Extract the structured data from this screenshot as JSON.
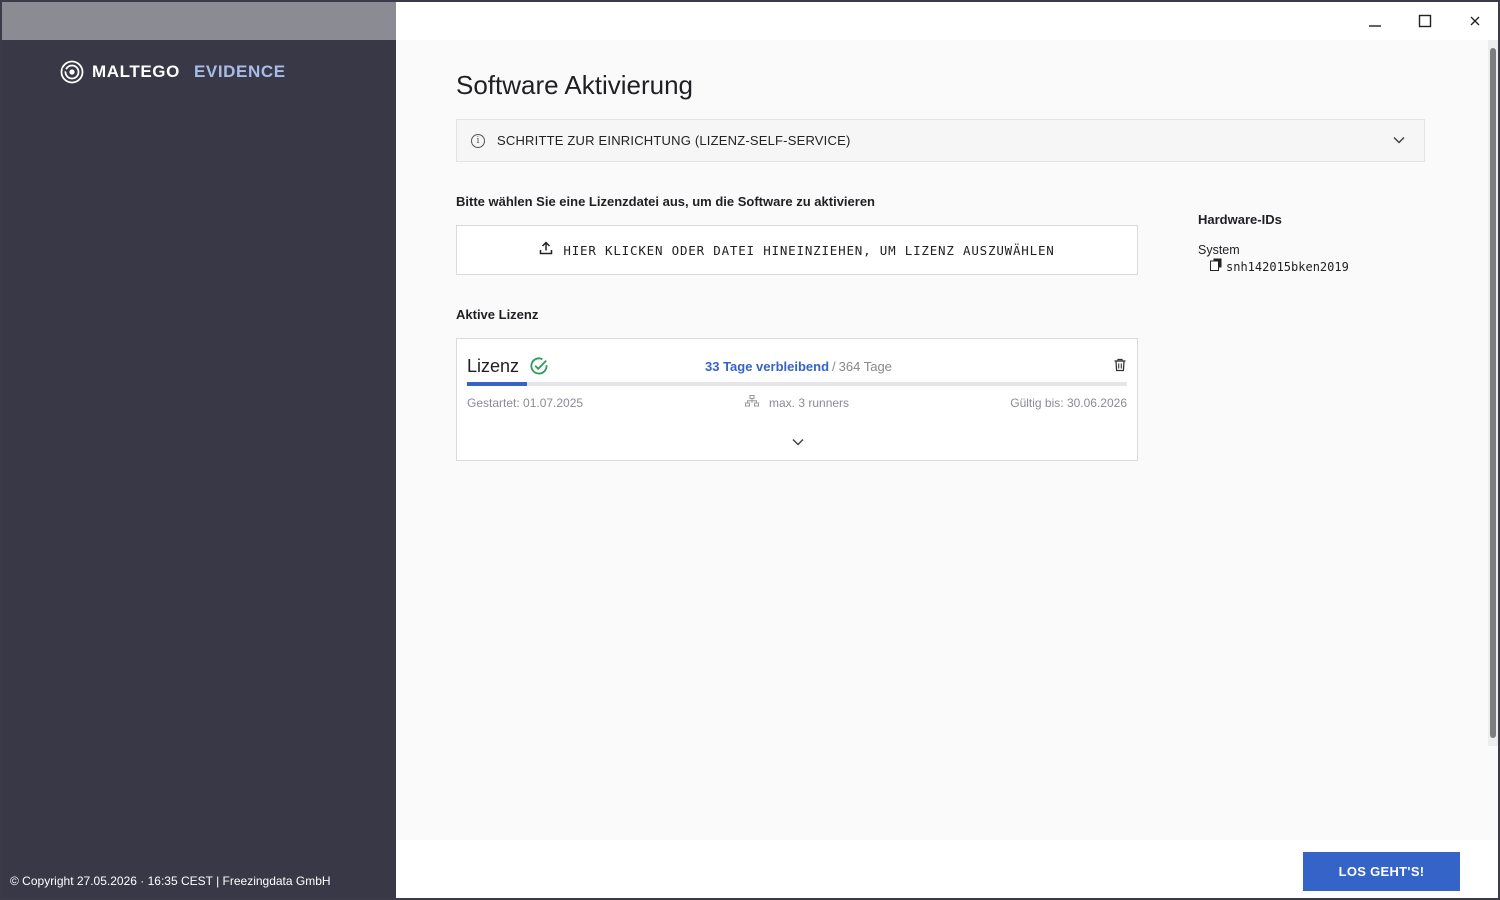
{
  "brand": {
    "name": "MALTEGO",
    "product": "EVIDENCE"
  },
  "window_controls": {
    "minimize": "—",
    "maximize": "☐",
    "close": "✕"
  },
  "page": {
    "title": "Software Aktivierung",
    "accordion_label": "SCHRITTE ZUR EINRICHTUNG (LIZENZ-SELF-SERVICE)",
    "select_hint": "Bitte wählen Sie eine Lizenzdatei aus, um die Software zu aktivieren",
    "upload_label": "HIER KLICKEN ODER DATEI HINEINZIEHEN, UM LIZENZ AUSZUWÄHLEN",
    "active_license_title": "Aktive Lizenz"
  },
  "license": {
    "name": "Lizenz",
    "days_remaining_label": "33 Tage verbleibend",
    "separator": "/",
    "total_days_label": "364 Tage",
    "progress_fraction": 0.0907,
    "started": "Gestartet: 01.07.2025",
    "runners": "max. 3 runners",
    "valid_until": "Gültig bis: 30.06.2026"
  },
  "hardware": {
    "title": "Hardware-IDs",
    "system_label": "System",
    "system_id": "snh142015bken2019"
  },
  "footer": {
    "copyright": "© Copyright 27.05.2026 · 16:35 CEST | Freezingdata GmbH",
    "button": "LOS GEHT'S!"
  },
  "colors": {
    "accent": "#3564c8",
    "sidebar": "#383846",
    "success": "#2e9d5a"
  }
}
